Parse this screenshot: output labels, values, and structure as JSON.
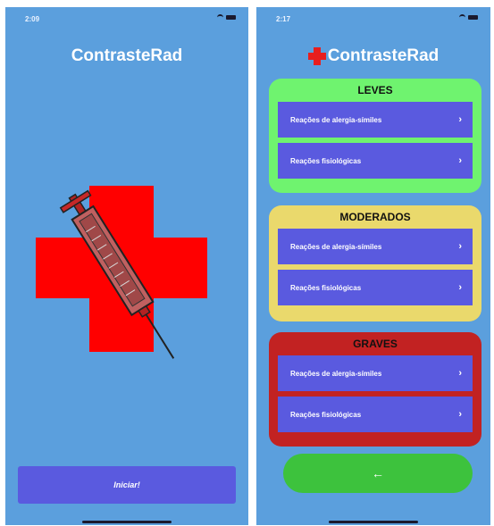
{
  "screen1": {
    "status": {
      "time": "2:09"
    },
    "title": "ContrasteRad",
    "start_button": "Iniciar!"
  },
  "screen2": {
    "status": {
      "time": "2:17"
    },
    "title": "ContrasteRad",
    "panels": [
      {
        "title": "LEVES",
        "color": "#6ff36f",
        "items": [
          "Reações de alergia-símiles",
          "Reações fisiológicas"
        ]
      },
      {
        "title": "MODERADOS",
        "color": "#ead96c",
        "items": [
          "Reações de alergia-símiles",
          "Reações fisiológicas"
        ]
      },
      {
        "title": "GRAVES",
        "color": "#c22222",
        "items": [
          "Reações de alergia-símiles",
          "Reações fisiológicas"
        ]
      }
    ],
    "chevron": "›",
    "back_button": "←"
  },
  "colors": {
    "background": "#5b9fdd",
    "button": "#5a5adf",
    "cross": "#e81e1e",
    "back": "#3dc23d"
  },
  "icons": [
    "wifi-icon",
    "battery-icon",
    "red-cross-icon",
    "syringe-icon",
    "chevron-right-icon",
    "arrow-left-icon"
  ]
}
